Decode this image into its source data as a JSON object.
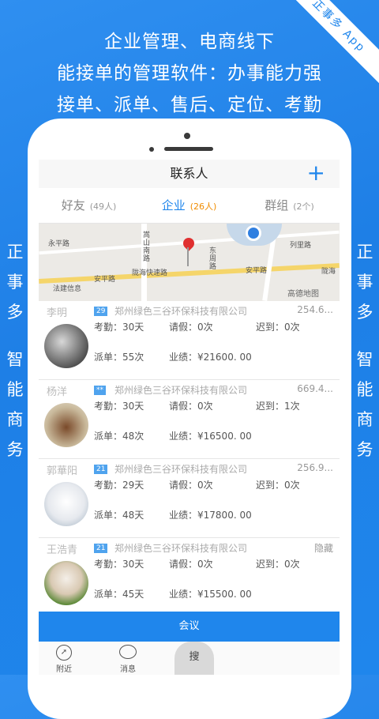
{
  "banner": {
    "corner_tag": "正事多 App",
    "line1": "企业管理、电商线下",
    "line2": "能接单的管理软件：办事能力强",
    "line3": "接单、派单、售后、定位、考勤",
    "left_vertical": [
      "正",
      "事",
      "多",
      "智",
      "能",
      "商",
      "务"
    ],
    "right_vertical": [
      "正",
      "事",
      "多",
      "智",
      "能",
      "商",
      "务"
    ]
  },
  "app": {
    "title": "联系人",
    "tabs": [
      {
        "label": "好友",
        "count": "(49人)"
      },
      {
        "label": "企业",
        "count": "(26人)"
      },
      {
        "label": "群组",
        "count": "(2个)"
      }
    ],
    "map": {
      "labels": [
        "永平路",
        "嵩山南路",
        "陇海快速路",
        "安平路",
        "安平路",
        "陇海",
        "东周路",
        "列里路",
        "法建信息",
        "高德地图"
      ]
    },
    "contacts": [
      {
        "name": "李明",
        "badge": "29",
        "company": "郑州绿色三谷环保科技有限公司",
        "distance": "254.6...",
        "attendance_label": "考勤：",
        "attendance": "30天",
        "leave_label": "请假：",
        "leave": "0次",
        "late_label": "迟到：",
        "late": "0次",
        "dispatch_label": "派单：",
        "dispatch": "55次",
        "perf_label": "业绩：",
        "perf": "¥21600. 00"
      },
      {
        "name": "杨洋",
        "badge": "**",
        "company": "郑州绿色三谷环保科技有限公司",
        "distance": "669.4...",
        "attendance_label": "考勤：",
        "attendance": "30天",
        "leave_label": "请假：",
        "leave": "0次",
        "late_label": "迟到：",
        "late": "1次",
        "dispatch_label": "派单：",
        "dispatch": "48次",
        "perf_label": "业绩：",
        "perf": "¥16500. 00"
      },
      {
        "name": "郭華阳",
        "badge": "21",
        "company": "郑州绿色三谷环保科技有限公司",
        "distance": "256.9...",
        "attendance_label": "考勤：",
        "attendance": "29天",
        "leave_label": "请假：",
        "leave": "0次",
        "late_label": "迟到：",
        "late": "0次",
        "dispatch_label": "派单：",
        "dispatch": "48天",
        "perf_label": "业绩：",
        "perf": "¥17800. 00"
      },
      {
        "name": "王浩青",
        "badge": "21",
        "company": "郑州绿色三谷环保科技有限公司",
        "distance": "隐藏",
        "attendance_label": "考勤：",
        "attendance": "30天",
        "leave_label": "请假：",
        "leave": "0次",
        "late_label": "迟到：",
        "late": "0次",
        "dispatch_label": "派单：",
        "dispatch": "45天",
        "perf_label": "业绩：",
        "perf": "¥15500. 00"
      }
    ],
    "meeting_button": "会议",
    "bottom_nav": [
      {
        "label": "附近"
      },
      {
        "label": "消息"
      },
      {
        "label": "搜"
      }
    ]
  }
}
